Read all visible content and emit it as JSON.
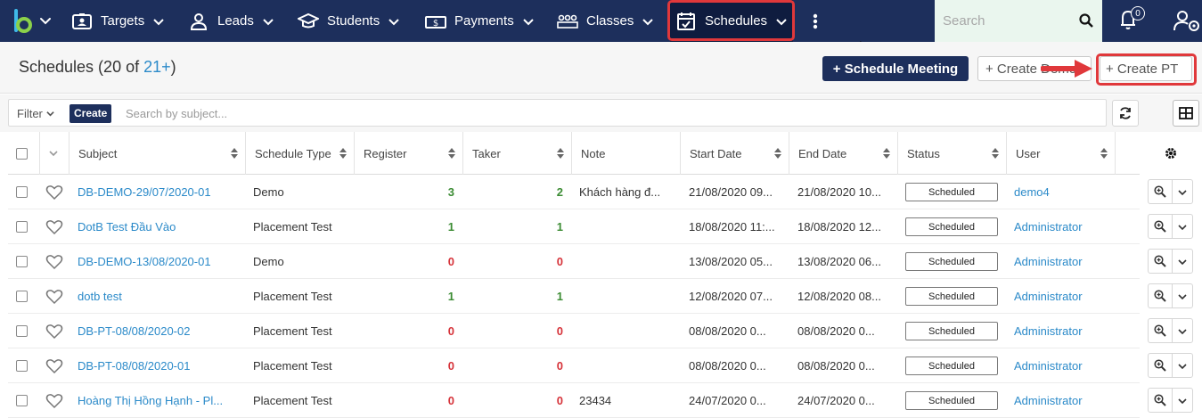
{
  "nav": {
    "items": [
      {
        "label": "Targets",
        "icon": "id-card-icon"
      },
      {
        "label": "Leads",
        "icon": "user-icon"
      },
      {
        "label": "Students",
        "icon": "graduation-cap-icon"
      },
      {
        "label": "Payments",
        "icon": "money-icon"
      },
      {
        "label": "Classes",
        "icon": "group-icon"
      },
      {
        "label": "Schedules",
        "icon": "calendar-check-icon"
      }
    ],
    "search_placeholder": "Search",
    "notification_count": "0"
  },
  "header": {
    "title": "Schedules (20 of ",
    "count": "21+",
    "title_end": ")",
    "schedule_meeting": "+ Schedule Meeting",
    "create_demo": "+ Create Demo",
    "create_pt": "+ Create PT"
  },
  "filter": {
    "label": "Filter",
    "create": "Create",
    "placeholder": "Search by subject..."
  },
  "table": {
    "columns": [
      "Subject",
      "Schedule Type",
      "Register",
      "Taker",
      "Note",
      "Start Date",
      "End Date",
      "Status",
      "User"
    ],
    "rows": [
      {
        "subject": "DB-DEMO-29/07/2020-01",
        "type": "Demo",
        "register": "3",
        "taker": "2",
        "note": "Khách hàng đ...",
        "start": "21/08/2020 09...",
        "end": "21/08/2020 10...",
        "status": "Scheduled",
        "user": "demo4"
      },
      {
        "subject": "DotB Test Đầu Vào",
        "type": "Placement Test",
        "register": "1",
        "taker": "1",
        "note": "",
        "start": "18/08/2020 11:...",
        "end": "18/08/2020 12...",
        "status": "Scheduled",
        "user": "Administrator"
      },
      {
        "subject": "DB-DEMO-13/08/2020-01",
        "type": "Demo",
        "register": "0",
        "taker": "0",
        "note": "",
        "start": "13/08/2020 05...",
        "end": "13/08/2020 06...",
        "status": "Scheduled",
        "user": "Administrator"
      },
      {
        "subject": "dotb test",
        "type": "Placement Test",
        "register": "1",
        "taker": "1",
        "note": "",
        "start": "12/08/2020 07...",
        "end": "12/08/2020 08...",
        "status": "Scheduled",
        "user": "Administrator"
      },
      {
        "subject": "DB-PT-08/08/2020-02",
        "type": "Placement Test",
        "register": "0",
        "taker": "0",
        "note": "",
        "start": "08/08/2020 0...",
        "end": "08/08/2020 0...",
        "status": "Scheduled",
        "user": "Administrator"
      },
      {
        "subject": "DB-PT-08/08/2020-01",
        "type": "Placement Test",
        "register": "0",
        "taker": "0",
        "note": "",
        "start": "08/08/2020 0...",
        "end": "08/08/2020 0...",
        "status": "Scheduled",
        "user": "Administrator"
      },
      {
        "subject": "Hoàng Thị Hồng Hạnh - Pl...",
        "type": "Placement Test",
        "register": "0",
        "taker": "0",
        "note": "23434",
        "start": "24/07/2020 0...",
        "end": "24/07/2020 0...",
        "status": "Scheduled",
        "user": "Administrator"
      }
    ]
  },
  "colors": {
    "nav_bg": "#1d2f5c",
    "link": "#2b8ac9",
    "highlight": "#e0383b",
    "positive": "#3c8c34",
    "negative": "#d6333a"
  }
}
